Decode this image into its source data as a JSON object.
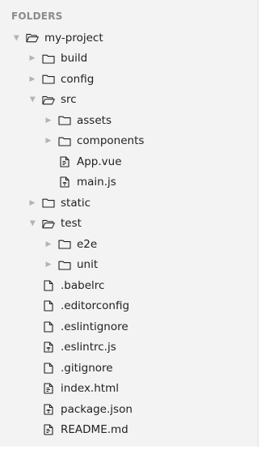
{
  "sidebar": {
    "header": "FOLDERS",
    "items": [
      {
        "label": "my-project",
        "type": "folder",
        "open": true,
        "depth": 0
      },
      {
        "label": "build",
        "type": "folder",
        "open": false,
        "depth": 1
      },
      {
        "label": "config",
        "type": "folder",
        "open": false,
        "depth": 1
      },
      {
        "label": "src",
        "type": "folder",
        "open": true,
        "depth": 1
      },
      {
        "label": "assets",
        "type": "folder",
        "open": false,
        "depth": 2
      },
      {
        "label": "components",
        "type": "folder",
        "open": false,
        "depth": 2
      },
      {
        "label": "App.vue",
        "type": "file",
        "icon": "file-code-icon",
        "depth": 2
      },
      {
        "label": "main.js",
        "type": "file",
        "icon": "file-js-icon",
        "depth": 2
      },
      {
        "label": "static",
        "type": "folder",
        "open": false,
        "depth": 1
      },
      {
        "label": "test",
        "type": "folder",
        "open": true,
        "depth": 1
      },
      {
        "label": "e2e",
        "type": "folder",
        "open": false,
        "depth": 2
      },
      {
        "label": "unit",
        "type": "folder",
        "open": false,
        "depth": 2
      },
      {
        "label": ".babelrc",
        "type": "file",
        "icon": "file-icon",
        "depth": 1
      },
      {
        "label": ".editorconfig",
        "type": "file",
        "icon": "file-icon",
        "depth": 1
      },
      {
        "label": ".eslintignore",
        "type": "file",
        "icon": "file-icon",
        "depth": 1
      },
      {
        "label": ".eslintrc.js",
        "type": "file",
        "icon": "file-js-icon",
        "depth": 1
      },
      {
        "label": ".gitignore",
        "type": "file",
        "icon": "file-icon",
        "depth": 1
      },
      {
        "label": "index.html",
        "type": "file",
        "icon": "file-code-icon",
        "depth": 1
      },
      {
        "label": "package.json",
        "type": "file",
        "icon": "file-js-icon",
        "depth": 1
      },
      {
        "label": "README.md",
        "type": "file",
        "icon": "file-code-icon",
        "depth": 1
      }
    ]
  }
}
